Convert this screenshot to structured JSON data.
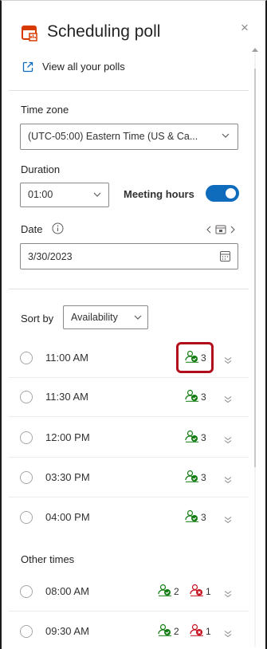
{
  "header": {
    "title": "Scheduling poll",
    "close": "×"
  },
  "view_all_link": "View all your polls",
  "time_zone": {
    "label": "Time zone",
    "value": "(UTC-05:00) Eastern Time (US & Ca..."
  },
  "duration": {
    "label": "Duration",
    "value": "01:00"
  },
  "meeting_hours": {
    "label": "Meeting hours",
    "on": true
  },
  "date": {
    "label": "Date",
    "value": "3/30/2023"
  },
  "sort": {
    "label": "Sort by",
    "value": "Availability"
  },
  "times": [
    {
      "time": "11:00 AM",
      "accepted": "3"
    },
    {
      "time": "11:30 AM",
      "accepted": "3"
    },
    {
      "time": "12:00 PM",
      "accepted": "3"
    },
    {
      "time": "03:30 PM",
      "accepted": "3"
    },
    {
      "time": "04:00 PM",
      "accepted": "3"
    }
  ],
  "other_times_label": "Other times",
  "other_times": [
    {
      "time": "08:00 AM",
      "accepted": "2",
      "declined": "1"
    },
    {
      "time": "09:30 AM",
      "accepted": "2",
      "declined": "1"
    }
  ],
  "colors": {
    "accent": "#0f6cbd",
    "available": "#107c10",
    "conflict": "#c50f1f",
    "highlight": "#b10e1c",
    "brand": "#d83b01"
  }
}
